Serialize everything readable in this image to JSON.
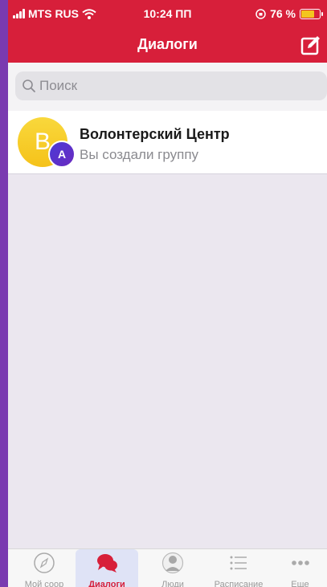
{
  "status_bar": {
    "carrier": "MTS RUS",
    "time": "10:24 ПП",
    "battery_percent": "76 %",
    "battery_level": 0.76
  },
  "header": {
    "title": "Диалоги"
  },
  "search": {
    "placeholder": "Поиск"
  },
  "dialogs": [
    {
      "avatar_letter": "B",
      "badge_letter": "A",
      "name": "Волонтерский Центр",
      "last_message": "Вы создали группу"
    }
  ],
  "tabbar": {
    "tabs": [
      {
        "label": "Мой соор",
        "icon": "compass-icon",
        "active": false
      },
      {
        "label": "Диалоги",
        "icon": "chat-bubbles-icon",
        "active": true
      },
      {
        "label": "Люди",
        "icon": "person-icon",
        "active": false
      },
      {
        "label": "Расписание",
        "icon": "list-icon",
        "active": false
      },
      {
        "label": "Еще",
        "icon": "more-dots-icon",
        "active": false
      }
    ]
  },
  "colors": {
    "accent": "#d71f3a",
    "background": "#ebe7ef",
    "frame": "#7a3ab0"
  }
}
